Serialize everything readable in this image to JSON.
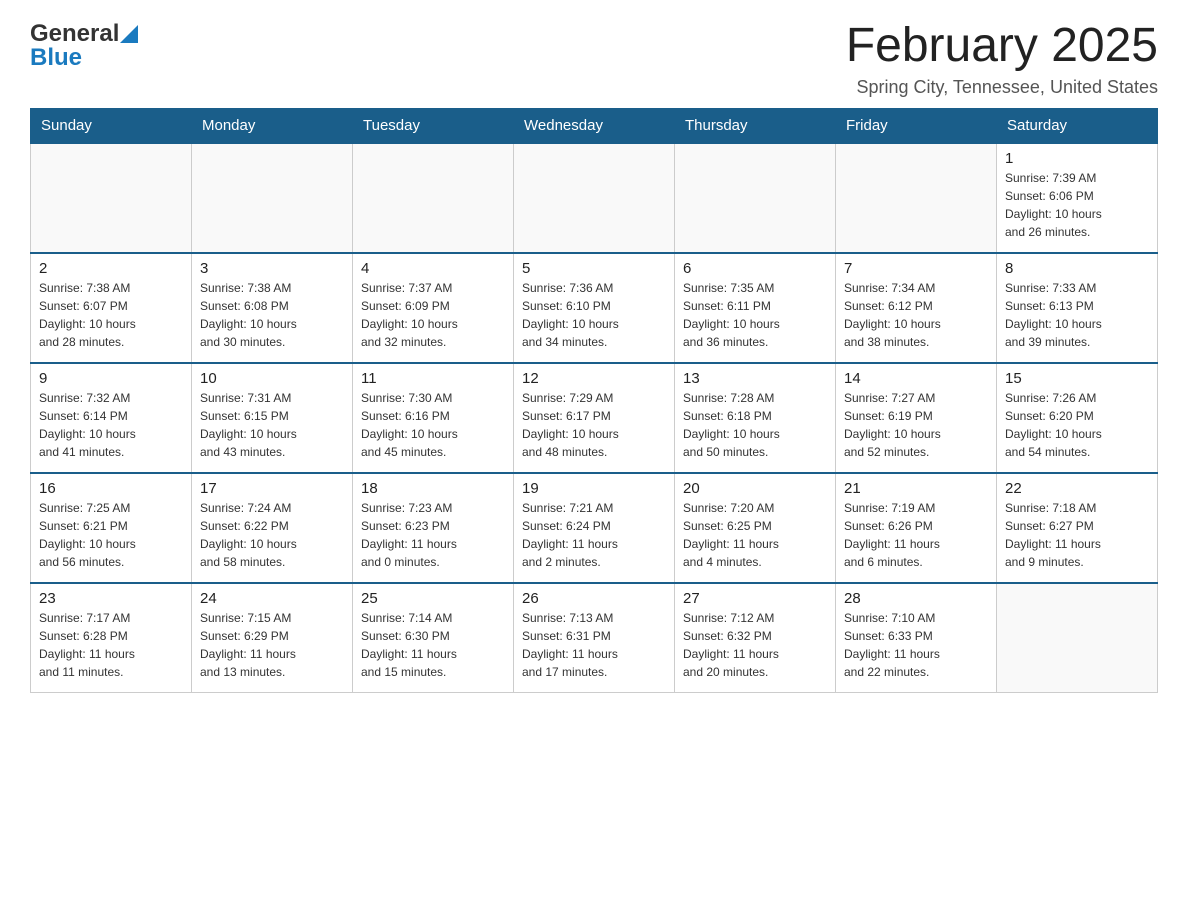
{
  "header": {
    "logo_general": "General",
    "logo_blue": "Blue",
    "month_title": "February 2025",
    "location": "Spring City, Tennessee, United States"
  },
  "weekdays": [
    "Sunday",
    "Monday",
    "Tuesday",
    "Wednesday",
    "Thursday",
    "Friday",
    "Saturday"
  ],
  "weeks": [
    [
      {
        "day": "",
        "info": ""
      },
      {
        "day": "",
        "info": ""
      },
      {
        "day": "",
        "info": ""
      },
      {
        "day": "",
        "info": ""
      },
      {
        "day": "",
        "info": ""
      },
      {
        "day": "",
        "info": ""
      },
      {
        "day": "1",
        "info": "Sunrise: 7:39 AM\nSunset: 6:06 PM\nDaylight: 10 hours\nand 26 minutes."
      }
    ],
    [
      {
        "day": "2",
        "info": "Sunrise: 7:38 AM\nSunset: 6:07 PM\nDaylight: 10 hours\nand 28 minutes."
      },
      {
        "day": "3",
        "info": "Sunrise: 7:38 AM\nSunset: 6:08 PM\nDaylight: 10 hours\nand 30 minutes."
      },
      {
        "day": "4",
        "info": "Sunrise: 7:37 AM\nSunset: 6:09 PM\nDaylight: 10 hours\nand 32 minutes."
      },
      {
        "day": "5",
        "info": "Sunrise: 7:36 AM\nSunset: 6:10 PM\nDaylight: 10 hours\nand 34 minutes."
      },
      {
        "day": "6",
        "info": "Sunrise: 7:35 AM\nSunset: 6:11 PM\nDaylight: 10 hours\nand 36 minutes."
      },
      {
        "day": "7",
        "info": "Sunrise: 7:34 AM\nSunset: 6:12 PM\nDaylight: 10 hours\nand 38 minutes."
      },
      {
        "day": "8",
        "info": "Sunrise: 7:33 AM\nSunset: 6:13 PM\nDaylight: 10 hours\nand 39 minutes."
      }
    ],
    [
      {
        "day": "9",
        "info": "Sunrise: 7:32 AM\nSunset: 6:14 PM\nDaylight: 10 hours\nand 41 minutes."
      },
      {
        "day": "10",
        "info": "Sunrise: 7:31 AM\nSunset: 6:15 PM\nDaylight: 10 hours\nand 43 minutes."
      },
      {
        "day": "11",
        "info": "Sunrise: 7:30 AM\nSunset: 6:16 PM\nDaylight: 10 hours\nand 45 minutes."
      },
      {
        "day": "12",
        "info": "Sunrise: 7:29 AM\nSunset: 6:17 PM\nDaylight: 10 hours\nand 48 minutes."
      },
      {
        "day": "13",
        "info": "Sunrise: 7:28 AM\nSunset: 6:18 PM\nDaylight: 10 hours\nand 50 minutes."
      },
      {
        "day": "14",
        "info": "Sunrise: 7:27 AM\nSunset: 6:19 PM\nDaylight: 10 hours\nand 52 minutes."
      },
      {
        "day": "15",
        "info": "Sunrise: 7:26 AM\nSunset: 6:20 PM\nDaylight: 10 hours\nand 54 minutes."
      }
    ],
    [
      {
        "day": "16",
        "info": "Sunrise: 7:25 AM\nSunset: 6:21 PM\nDaylight: 10 hours\nand 56 minutes."
      },
      {
        "day": "17",
        "info": "Sunrise: 7:24 AM\nSunset: 6:22 PM\nDaylight: 10 hours\nand 58 minutes."
      },
      {
        "day": "18",
        "info": "Sunrise: 7:23 AM\nSunset: 6:23 PM\nDaylight: 11 hours\nand 0 minutes."
      },
      {
        "day": "19",
        "info": "Sunrise: 7:21 AM\nSunset: 6:24 PM\nDaylight: 11 hours\nand 2 minutes."
      },
      {
        "day": "20",
        "info": "Sunrise: 7:20 AM\nSunset: 6:25 PM\nDaylight: 11 hours\nand 4 minutes."
      },
      {
        "day": "21",
        "info": "Sunrise: 7:19 AM\nSunset: 6:26 PM\nDaylight: 11 hours\nand 6 minutes."
      },
      {
        "day": "22",
        "info": "Sunrise: 7:18 AM\nSunset: 6:27 PM\nDaylight: 11 hours\nand 9 minutes."
      }
    ],
    [
      {
        "day": "23",
        "info": "Sunrise: 7:17 AM\nSunset: 6:28 PM\nDaylight: 11 hours\nand 11 minutes."
      },
      {
        "day": "24",
        "info": "Sunrise: 7:15 AM\nSunset: 6:29 PM\nDaylight: 11 hours\nand 13 minutes."
      },
      {
        "day": "25",
        "info": "Sunrise: 7:14 AM\nSunset: 6:30 PM\nDaylight: 11 hours\nand 15 minutes."
      },
      {
        "day": "26",
        "info": "Sunrise: 7:13 AM\nSunset: 6:31 PM\nDaylight: 11 hours\nand 17 minutes."
      },
      {
        "day": "27",
        "info": "Sunrise: 7:12 AM\nSunset: 6:32 PM\nDaylight: 11 hours\nand 20 minutes."
      },
      {
        "day": "28",
        "info": "Sunrise: 7:10 AM\nSunset: 6:33 PM\nDaylight: 11 hours\nand 22 minutes."
      },
      {
        "day": "",
        "info": ""
      }
    ]
  ]
}
